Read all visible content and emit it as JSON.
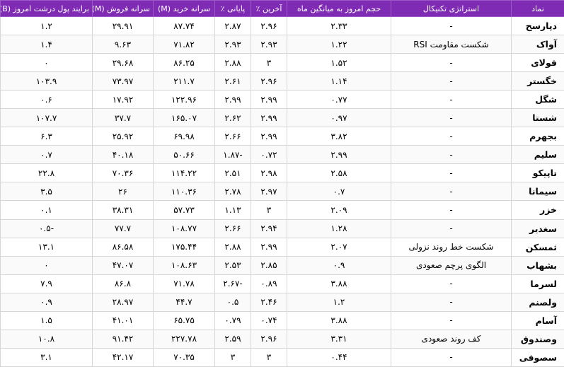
{
  "headers": {
    "symbol": "نماد",
    "strategy": "استراتژی تکنیکال",
    "volume_ratio": "حجم امروز به میانگین ماه",
    "last_pct": "آخرین ٪",
    "close_pct": "پایانی ٪",
    "buy_per_capita": "سرانه خرید (M)",
    "sell_per_capita": "سرانه فروش (M)",
    "money_flow": "برایند پول درشت امروز (B)"
  },
  "rows": [
    {
      "symbol": "دپارسح",
      "strategy": "-",
      "volume_ratio": "۲.۳۳",
      "last_pct": "۲.۹۶",
      "close_pct": "۲.۸۷",
      "buy": "۸۷.۷۴",
      "sell": "۲۹.۹۱",
      "flow": "۱.۲"
    },
    {
      "symbol": "آواک",
      "strategy": "شکست مقاومت RSI",
      "volume_ratio": "۱.۲۲",
      "last_pct": "۲.۹۳",
      "close_pct": "۲.۹۳",
      "buy": "۷۱.۸۲",
      "sell": "۹.۶۳",
      "flow": "۱.۴"
    },
    {
      "symbol": "فولای",
      "strategy": "-",
      "volume_ratio": "۱.۵۲",
      "last_pct": "۳",
      "close_pct": "۲.۸۸",
      "buy": "۸۶.۲۵",
      "sell": "۲۹.۶۸",
      "flow": "۰"
    },
    {
      "symbol": "خگستر",
      "strategy": "-",
      "volume_ratio": "۱.۱۴",
      "last_pct": "۲.۹۶",
      "close_pct": "۲.۶۱",
      "buy": "۲۱۱.۷",
      "sell": "۷۳.۹۷",
      "flow": "۱۰۳.۹"
    },
    {
      "symbol": "شگل",
      "strategy": "-",
      "volume_ratio": "۰.۷۷",
      "last_pct": "۲.۹۹",
      "close_pct": "۲.۹۹",
      "buy": "۱۲۲.۹۶",
      "sell": "۱۷.۹۲",
      "flow": "۰.۶"
    },
    {
      "symbol": "شستا",
      "strategy": "-",
      "volume_ratio": "۰.۹۷",
      "last_pct": "۲.۹۹",
      "close_pct": "۲.۶۲",
      "buy": "۱۶۵.۰۷",
      "sell": "۳۷.۷",
      "flow": "۱۰۷.۷"
    },
    {
      "symbol": "بجهرم",
      "strategy": "-",
      "volume_ratio": "۳.۸۲",
      "last_pct": "۲.۹۹",
      "close_pct": "۲.۶۶",
      "buy": "۶۹.۹۸",
      "sell": "۲۵.۹۲",
      "flow": "۶.۳"
    },
    {
      "symbol": "سلیم",
      "strategy": "-",
      "volume_ratio": "۲.۹۹",
      "last_pct": "۰.۷۲",
      "close_pct": "-۱.۸۷",
      "buy": "۵۰.۶۶",
      "sell": "۴۰.۱۸",
      "flow": "۰.۷"
    },
    {
      "symbol": "تاپیکو",
      "strategy": "-",
      "volume_ratio": "۲.۵۸",
      "last_pct": "۲.۹۸",
      "close_pct": "۲.۵۱",
      "buy": "۱۱۴.۲۲",
      "sell": "۷۰.۳۶",
      "flow": "۲۲.۸"
    },
    {
      "symbol": "سیمانا",
      "strategy": "-",
      "volume_ratio": "۰.۷",
      "last_pct": "۲.۹۷",
      "close_pct": "۲.۷۸",
      "buy": "۱۱۰.۳۶",
      "sell": "۲۶",
      "flow": "۳.۵"
    },
    {
      "symbol": "خزر",
      "strategy": "-",
      "volume_ratio": "۲.۰۹",
      "last_pct": "۳",
      "close_pct": "۱.۱۳",
      "buy": "۵۷.۷۳",
      "sell": "۳۸.۳۱",
      "flow": "۰.۱"
    },
    {
      "symbol": "سغدیر",
      "strategy": "-",
      "volume_ratio": "۱.۲۸",
      "last_pct": "۲.۹۴",
      "close_pct": "۲.۶۶",
      "buy": "۱۰۸.۷۷",
      "sell": "۷۷.۷",
      "flow": "-۰.۵"
    },
    {
      "symbol": "ثمسکن",
      "strategy": "شکست خط روند نزولی",
      "volume_ratio": "۲.۰۷",
      "last_pct": "۲.۹۹",
      "close_pct": "۲.۸۸",
      "buy": "۱۷۵.۴۴",
      "sell": "۸۶.۵۸",
      "flow": "۱۳.۱"
    },
    {
      "symbol": "بشهاب",
      "strategy": "الگوی پرچم صعودی",
      "volume_ratio": "۰.۹",
      "last_pct": "۲.۸۵",
      "close_pct": "۲.۵۳",
      "buy": "۱۰۸.۶۳",
      "sell": "۴۷.۰۷",
      "flow": "۰"
    },
    {
      "symbol": "لسرما",
      "strategy": "-",
      "volume_ratio": "۳.۸۸",
      "last_pct": "۰.۸۹",
      "close_pct": "-۲.۶۷",
      "buy": "۷۱.۷۸",
      "sell": "۸۶.۸",
      "flow": "۷.۹"
    },
    {
      "symbol": "ولصنم",
      "strategy": "-",
      "volume_ratio": "۱.۲",
      "last_pct": "۲.۴۶",
      "close_pct": "۰.۵",
      "buy": "۴۴.۷",
      "sell": "۲۸.۹۷",
      "flow": "۰.۹"
    },
    {
      "symbol": "آسام",
      "strategy": "-",
      "volume_ratio": "۳.۸۸",
      "last_pct": "۰.۷۴",
      "close_pct": "۰.۷۹",
      "buy": "۶۵.۷۵",
      "sell": "۴۱.۰۱",
      "flow": "۱.۵"
    },
    {
      "symbol": "وصندوق",
      "strategy": "کف روند صعودی",
      "volume_ratio": "۳.۳۱",
      "last_pct": "۲.۹۶",
      "close_pct": "۲.۵۹",
      "buy": "۲۲۷.۷۸",
      "sell": "۹۱.۴۲",
      "flow": "۱۰.۸"
    },
    {
      "symbol": "سصوفی",
      "strategy": "-",
      "volume_ratio": "۰.۴۴",
      "last_pct": "۳",
      "close_pct": "۳",
      "buy": "۷۰.۳۵",
      "sell": "۴۲.۱۷",
      "flow": "۳.۱"
    }
  ]
}
